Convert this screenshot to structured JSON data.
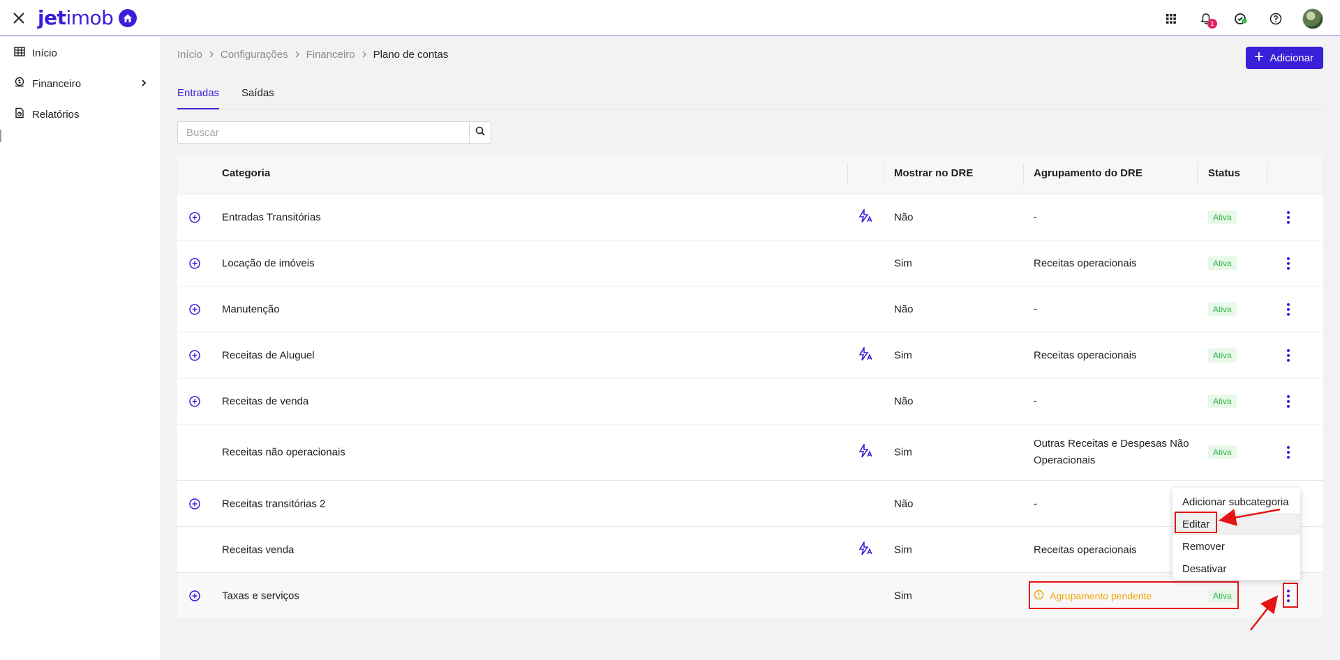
{
  "app": {
    "logo_prefix": "jet",
    "logo_suffix": "imob",
    "notifications_count": "1",
    "brand_color": "#3a1fd8"
  },
  "icons": {
    "close": "close-icon",
    "home": "home-icon",
    "apps": "apps-grid-icon",
    "bell": "bell-icon",
    "status": "status-icon",
    "help": "help-icon"
  },
  "sidebar": {
    "items": [
      {
        "label": "Início",
        "icon": "table-icon"
      },
      {
        "label": "Financeiro",
        "icon": "wallet-icon"
      },
      {
        "label": "Relatórios",
        "icon": "report-icon"
      }
    ]
  },
  "breadcrumb": {
    "items": [
      "Início",
      "Configurações",
      "Financeiro"
    ],
    "current": "Plano de contas"
  },
  "header": {
    "add_label": "Adicionar"
  },
  "tabs": [
    {
      "label": "Entradas",
      "active": true
    },
    {
      "label": "Saídas",
      "active": false
    }
  ],
  "search": {
    "placeholder": "Buscar",
    "value": ""
  },
  "table": {
    "columns": {
      "category": "Categoria",
      "show_dre": "Mostrar no DRE",
      "grouping": "Agrupamento do DRE",
      "status": "Status"
    },
    "rows": [
      {
        "category": "Entradas Transitórias",
        "auto": true,
        "expandable": true,
        "show_dre": "Não",
        "grouping": "-",
        "status": "Ativa"
      },
      {
        "category": "Locação de imóveis",
        "auto": false,
        "expandable": true,
        "show_dre": "Sim",
        "grouping": "Receitas operacionais",
        "status": "Ativa"
      },
      {
        "category": "Manutenção",
        "auto": false,
        "expandable": true,
        "show_dre": "Não",
        "grouping": "-",
        "status": "Ativa"
      },
      {
        "category": "Receitas de Aluguel",
        "auto": true,
        "expandable": true,
        "show_dre": "Sim",
        "grouping": "Receitas operacionais",
        "status": "Ativa"
      },
      {
        "category": "Receitas de venda",
        "auto": false,
        "expandable": true,
        "show_dre": "Não",
        "grouping": "-",
        "status": "Ativa"
      },
      {
        "category": "Receitas não operacionais",
        "auto": true,
        "expandable": false,
        "show_dre": "Sim",
        "grouping": "Outras Receitas e Despesas Não",
        "grouping_line2": "Operacionais",
        "status": "Ativa"
      },
      {
        "category": "Receitas transitórias 2",
        "auto": false,
        "expandable": true,
        "show_dre": "Não",
        "grouping": "-",
        "status": ""
      },
      {
        "category": "Receitas venda",
        "auto": true,
        "expandable": false,
        "show_dre": "Sim",
        "grouping": "Receitas operacionais",
        "status": ""
      },
      {
        "category": "Taxas e serviços",
        "auto": false,
        "expandable": true,
        "show_dre": "Sim",
        "grouping": "Agrupamento pendente",
        "status": "Ativa",
        "pending": true
      }
    ]
  },
  "context_menu": {
    "items": [
      "Adicionar subcategoria",
      "Editar",
      "Remover",
      "Desativar"
    ]
  },
  "colors": {
    "active_badge_bg": "#e8f8e8",
    "active_badge_text": "#34b34a",
    "pending": "#f2a100",
    "annotation": "#e51414"
  }
}
